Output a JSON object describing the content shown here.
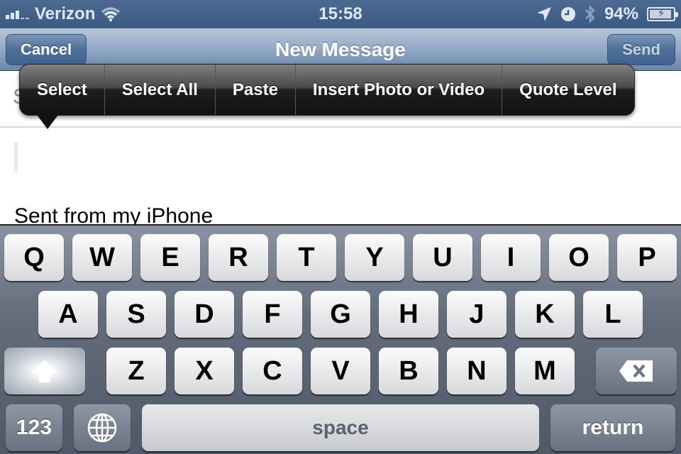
{
  "status_bar": {
    "carrier": "Verizon",
    "time": "15:58",
    "battery_percent_label": "94%",
    "battery_level": 0.94,
    "icons": [
      "signal-bars-icon",
      "wifi-icon",
      "location-arrow-icon",
      "alarm-clock-icon",
      "bluetooth-icon",
      "battery-charging-icon"
    ]
  },
  "nav": {
    "title": "New Message",
    "cancel_label": "Cancel",
    "send_label": "Send"
  },
  "compose": {
    "subject_label_partial": "S",
    "signature": "Sent from my iPhone"
  },
  "edit_menu": {
    "items": [
      "Select",
      "Select All",
      "Paste",
      "Insert Photo or Video",
      "Quote Level"
    ]
  },
  "keyboard": {
    "row1": [
      "Q",
      "W",
      "E",
      "R",
      "T",
      "Y",
      "U",
      "I",
      "O",
      "P"
    ],
    "row2": [
      "A",
      "S",
      "D",
      "F",
      "G",
      "H",
      "J",
      "K",
      "L"
    ],
    "row3": [
      "Z",
      "X",
      "C",
      "V",
      "B",
      "N",
      "M"
    ],
    "numbers_label": "123",
    "space_label": "space",
    "return_label": "return"
  }
}
